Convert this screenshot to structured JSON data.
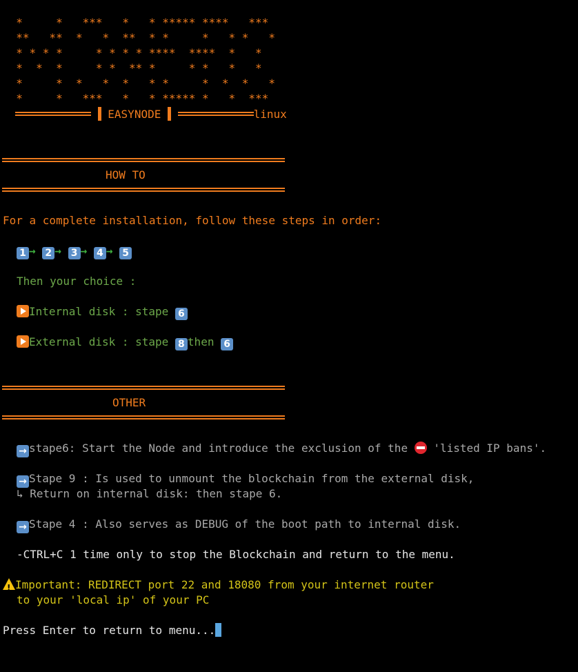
{
  "ascii_logo": [
    "  *     *   ***   *   * ***** ****   ***",
    "  **   **  *   *  **  * *     *   * *   *",
    "  * * * *     * * * * ****  ****  *   *",
    "  *  *  *     * *  ** *     * *   *   *",
    "  *     *  *   *  *   * *     *  *  *   *",
    "  *     *   ***   *   * ***** *   *  ***"
  ],
  "banner": {
    "title": "EASYNODE",
    "suffix": "linux"
  },
  "sections": {
    "howto_title": "HOW TO",
    "other_title": "OTHER"
  },
  "howto": {
    "intro": "For a complete installation, follow these steps in order:",
    "steps": [
      "1",
      "2",
      "3",
      "4",
      "5"
    ],
    "choice": "Then your choice :",
    "internal_label": "Internal disk : stape ",
    "internal_step": "6",
    "external_label": "External disk : stape ",
    "external_step_a": "8",
    "external_then": "then ",
    "external_step_b": "6"
  },
  "other": {
    "stape6_text": "stape6: Start the Node and introduce the exclusion of the ",
    "stape6_quote": " 'listed IP bans'.",
    "stape9_text": "Stape 9 : Is used to unmount the blockchain from the external disk,",
    "stape9_sub": "↳ Return on internal disk: then stape 6.",
    "stape4_text": "Stape 4 : Also serves as DEBUG of the boot path to internal disk.",
    "ctrl_c": "-CTRL+C 1 time only to stop the Blockchain and return to the menu.",
    "important_1": "Important: REDIRECT port 22 and 18080 from your internet router",
    "important_2": "to your 'local ip' of your PC"
  },
  "prompt": "Press Enter to return to menu...",
  "colors": {
    "accent_orange": "#f07c1e",
    "green_text": "#6ca84a",
    "gray_text": "#a9a9a9",
    "yellow_text": "#d4c418",
    "cursor": "#5aa6e0"
  }
}
